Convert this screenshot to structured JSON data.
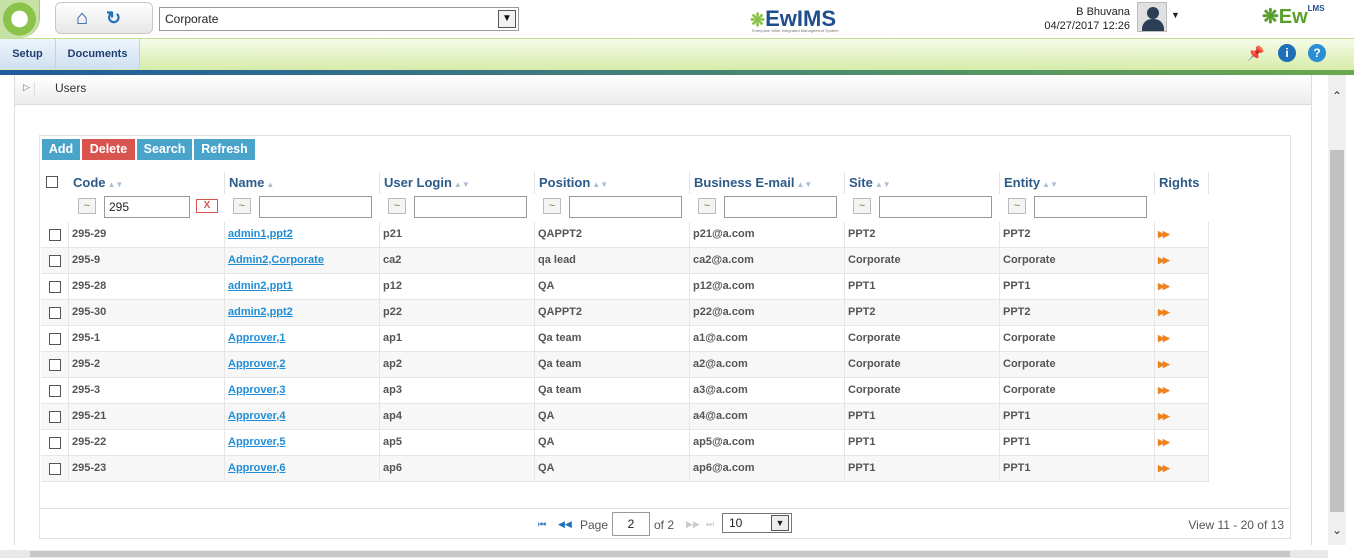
{
  "header": {
    "org_select": "Corporate",
    "brand_left": "EwIMS",
    "brand_tagline": "Enterprise Wide Integrated Management System",
    "user_name": "B Bhuvana",
    "user_time": "04/27/2017 12:26",
    "brand_right": "Ew",
    "brand_right_sup": "LMS",
    "brand_right_sub": "QMS"
  },
  "menu": {
    "setup": "Setup",
    "documents": "Documents"
  },
  "section": {
    "title": "Users"
  },
  "toolbar": {
    "add": "Add",
    "delete": "Delete",
    "search": "Search",
    "refresh": "Refresh"
  },
  "columns": [
    "Code",
    "Name",
    "User Login",
    "Position",
    "Business E-mail",
    "Site",
    "Entity",
    "Rights"
  ],
  "filters": {
    "code": "295",
    "clear": "X",
    "tilde": "~"
  },
  "rows": [
    {
      "code": "295-29",
      "name": "admin1,ppt2",
      "login": "p21",
      "position": "QAPPT2",
      "email": "p21@a.com",
      "site": "PPT2",
      "entity": "PPT2"
    },
    {
      "code": "295-9",
      "name": "Admin2,Corporate",
      "login": "ca2",
      "position": "qa lead",
      "email": "ca2@a.com",
      "site": "Corporate",
      "entity": "Corporate"
    },
    {
      "code": "295-28",
      "name": "admin2,ppt1",
      "login": "p12",
      "position": "QA",
      "email": "p12@a.com",
      "site": "PPT1",
      "entity": "PPT1"
    },
    {
      "code": "295-30",
      "name": "admin2,ppt2",
      "login": "p22",
      "position": "QAPPT2",
      "email": "p22@a.com",
      "site": "PPT2",
      "entity": "PPT2"
    },
    {
      "code": "295-1",
      "name": "Approver,1",
      "login": "ap1",
      "position": "Qa team",
      "email": "a1@a.com",
      "site": "Corporate",
      "entity": "Corporate"
    },
    {
      "code": "295-2",
      "name": "Approver,2",
      "login": "ap2",
      "position": "Qa team",
      "email": "a2@a.com",
      "site": "Corporate",
      "entity": "Corporate"
    },
    {
      "code": "295-3",
      "name": "Approver,3",
      "login": "ap3",
      "position": "Qa team",
      "email": "a3@a.com",
      "site": "Corporate",
      "entity": "Corporate"
    },
    {
      "code": "295-21",
      "name": "Approver,4",
      "login": "ap4",
      "position": "QA",
      "email": "a4@a.com",
      "site": "PPT1",
      "entity": "PPT1"
    },
    {
      "code": "295-22",
      "name": "Approver,5",
      "login": "ap5",
      "position": "QA",
      "email": "ap5@a.com",
      "site": "PPT1",
      "entity": "PPT1"
    },
    {
      "code": "295-23",
      "name": "Approver,6",
      "login": "ap6",
      "position": "QA",
      "email": "ap6@a.com",
      "site": "PPT1",
      "entity": "PPT1"
    }
  ],
  "pager": {
    "page_label": "Page",
    "page_value": "2",
    "of_label": "of 2",
    "page_size": "10",
    "view_text": "View 11 - 20 of 13"
  },
  "colors": {
    "accent": "#4aa3c8",
    "danger": "#d9534f",
    "link": "#1f8ed6",
    "header_text": "#2d5a88"
  }
}
